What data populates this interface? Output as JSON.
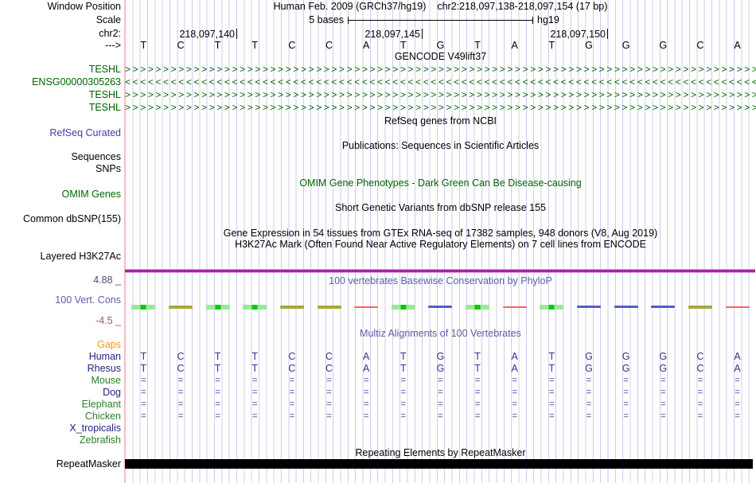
{
  "ruler": {
    "window_position_label": "Window Position",
    "assembly_title": "Human Feb. 2009 (GRCh37/hg19)",
    "position_range": "chr2:218,097,138-218,097,154 (17 bp)",
    "scale_label": "Scale",
    "scale_value": "5 bases",
    "assembly_short": "hg19",
    "chrom_label": "chr2:",
    "strand_arrow": "--->",
    "ticks": [
      "218,097,140",
      "218,097,145",
      "218,097,150"
    ]
  },
  "sequence": {
    "bases": [
      "T",
      "C",
      "T",
      "T",
      "C",
      "C",
      "A",
      "T",
      "G",
      "T",
      "A",
      "T",
      "G",
      "G",
      "G",
      "C",
      "A"
    ]
  },
  "tracks": {
    "gencode": {
      "title": "GENCODE V49lift37",
      "genes": [
        {
          "label": "TESHL",
          "strand": "right",
          "arrows": ">>>>>>>>>>>>>>>>>>>>>>>>>>>>>>>>>>>>>>>>>>>>>>>>>>>>>>>>>>>>>>>>>>>>>>>>>>>>>>>>>>>>>>>>>>"
        },
        {
          "label": "ENSG00000305263",
          "strand": "left",
          "arrows": "<<<<<<<<<<<<<<<<<<<<<<<<<<<<<<<<<<<<<<<<<<<<<<<<<<<<<<<<<<<<<<<<<<<<<<<<<<<<<<<<<<<<<<<<<<"
        },
        {
          "label": "TESHL",
          "strand": "right",
          "arrows": ">>>>>>>>>>>>>>>>>>>>>>>>>>>>>>>>>>>>>>>>>>>>>>>>>>>>>>>>>>>>>>>>>>>>>>>>>>>>>>>>>>>>>>>>>>"
        },
        {
          "label": "TESHL",
          "strand": "right",
          "arrows": ">>>>>>>>>>>>>>>>>>>>>>>>>>>>>>>>>>>>>>>>>>>>>>>>>>>>>>>>>>>>>>>>>>>>>>>>>>>>>>>>>>>>>>>>>>"
        }
      ]
    },
    "refseq": {
      "title": "RefSeq genes from NCBI",
      "label": "RefSeq Curated"
    },
    "publications": {
      "title": "Publications: Sequences in Scientific Articles",
      "label_sequences": "Sequences",
      "label_snps": "SNPs"
    },
    "omim": {
      "title": "OMIM Gene Phenotypes - Dark Green Can Be Disease-causing",
      "label": "OMIM Genes"
    },
    "dbsnp": {
      "title": "Short Genetic Variants from dbSNP release 155",
      "label": "Common dbSNP(155)"
    },
    "gtex": {
      "title": "Gene Expression in 54 tissues from GTEx RNA-seq of 17382 samples, 948 donors (V8, Aug 2019)"
    },
    "h3k27ac": {
      "title": "H3K27Ac Mark (Often Found Near Active Regulatory Elements) on 7 cell lines from ENCODE",
      "label": "Layered H3K27Ac"
    },
    "conservation": {
      "title": "100 vertebrates Basewise Conservation by PhyloP",
      "label": "100 Vert. Cons",
      "max_label": "4.88 _",
      "min_label": "-4.5 _",
      "marks": [
        {
          "color": "green"
        },
        {
          "color": "olive"
        },
        {
          "color": "green"
        },
        {
          "color": "green"
        },
        {
          "color": "olive"
        },
        {
          "color": "olive"
        },
        {
          "color": "red"
        },
        {
          "color": "green"
        },
        {
          "color": "blue"
        },
        {
          "color": "green"
        },
        {
          "color": "red"
        },
        {
          "color": "green"
        },
        {
          "color": "blue"
        },
        {
          "color": "blue"
        },
        {
          "color": "blue"
        },
        {
          "color": "olive"
        },
        {
          "color": "red"
        }
      ]
    },
    "multiz": {
      "title": "Multiz Alignments of 100 Vertebrates",
      "species": [
        {
          "name": "Gaps",
          "color": "orange",
          "cells": []
        },
        {
          "name": "Human",
          "color": "navy",
          "cells": [
            "T",
            "C",
            "T",
            "T",
            "C",
            "C",
            "A",
            "T",
            "G",
            "T",
            "A",
            "T",
            "G",
            "G",
            "G",
            "C",
            "A"
          ]
        },
        {
          "name": "Rhesus",
          "color": "navy",
          "cells": [
            "T",
            "C",
            "T",
            "T",
            "C",
            "C",
            "A",
            "T",
            "G",
            "T",
            "A",
            "T",
            "G",
            "G",
            "G",
            "C",
            "A"
          ]
        },
        {
          "name": "Mouse",
          "color": "green",
          "cells": [
            "=",
            "=",
            "=",
            "=",
            "=",
            "=",
            "=",
            "=",
            "=",
            "=",
            "=",
            "=",
            "=",
            "=",
            "=",
            "=",
            "="
          ]
        },
        {
          "name": "Dog",
          "color": "navy",
          "cells": [
            "=",
            "=",
            "=",
            "=",
            "=",
            "=",
            "=",
            "=",
            "=",
            "=",
            "=",
            "=",
            "=",
            "=",
            "=",
            "=",
            "="
          ]
        },
        {
          "name": "Elephant",
          "color": "green",
          "cells": [
            "=",
            "=",
            "=",
            "=",
            "=",
            "=",
            "=",
            "=",
            "=",
            "=",
            "=",
            "=",
            "=",
            "=",
            "=",
            "=",
            "="
          ]
        },
        {
          "name": "Chicken",
          "color": "green",
          "cells": [
            "=",
            "=",
            "=",
            "=",
            "=",
            "=",
            "=",
            "=",
            "=",
            "=",
            "=",
            "=",
            "=",
            "=",
            "=",
            "=",
            "="
          ]
        },
        {
          "name": "X_tropicalis",
          "color": "navy",
          "cells": []
        },
        {
          "name": "Zebrafish",
          "color": "green",
          "cells": []
        }
      ]
    },
    "repeatmasker": {
      "title": "Repeating Elements by RepeatMasker",
      "label": "RepeatMasker"
    }
  },
  "colors": {
    "gene_green": "#006400",
    "link_blue": "#4040a0",
    "conservation_blue": "#5c5ca8",
    "alignment_navy": "#32328e",
    "species_green": "#2a7e2a",
    "gaps_orange": "#ff9800",
    "purple_bar": "#a125a1",
    "min_maroon": "#a05858",
    "gridline": "#ccccee",
    "guide_pink": "#f7baba",
    "repeat_black": "#000000",
    "mark_green": "#00cc00",
    "mark_olive": "#a8a838",
    "mark_red": "#ff6161",
    "mark_blue": "#5858c8"
  }
}
